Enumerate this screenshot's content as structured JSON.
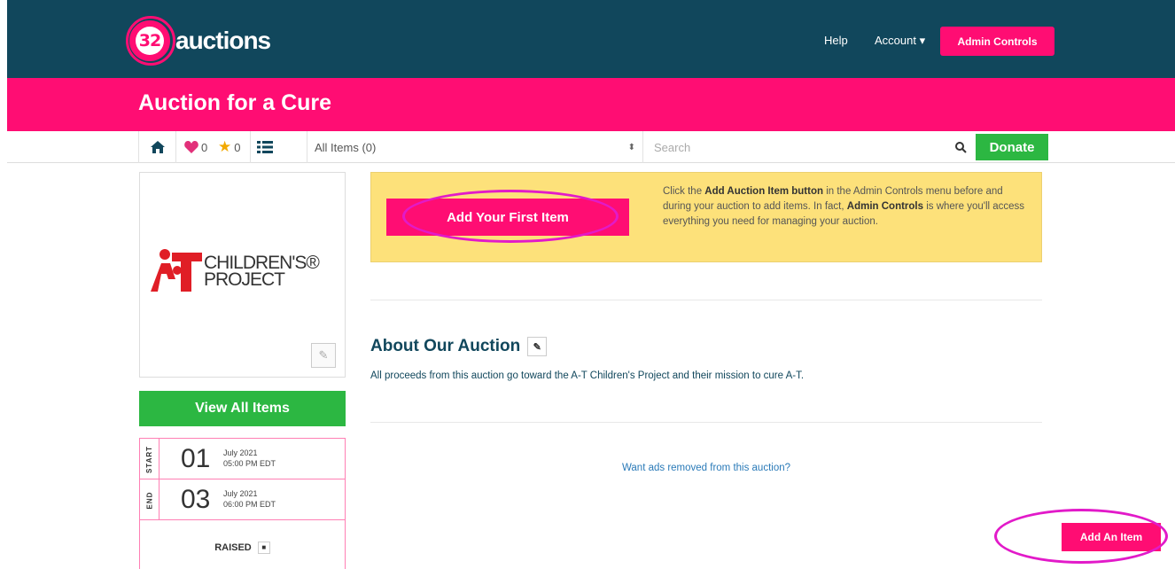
{
  "brand": {
    "logo_number": "32",
    "logo_text": "auctions"
  },
  "nav": {
    "help": "Help",
    "account": "Account ▾",
    "admin_controls": "Admin Controls"
  },
  "auction": {
    "title": "Auction for a Cure"
  },
  "toolbar": {
    "heart_count": "0",
    "star_count": "0",
    "filter_value": "All Items (0)",
    "search_placeholder": "Search",
    "donate": "Donate"
  },
  "org": {
    "name_line1": "CHILDREN'S®",
    "name_line2": "PROJECT"
  },
  "sidebar": {
    "view_all": "View All Items",
    "start_label": "START",
    "start_day": "01",
    "start_month": "July 2021",
    "start_time": "05:00 PM EDT",
    "end_label": "END",
    "end_day": "03",
    "end_month": "July 2021",
    "end_time": "06:00 PM EDT",
    "raised": "RAISED"
  },
  "hint": {
    "button": "Add Your First Item",
    "text_1": "Click the ",
    "bold_1": "Add Auction Item button",
    "text_2": " in the Admin Controls menu before and during your auction to add items. In fact, ",
    "bold_2": "Admin Controls",
    "text_3": " is where you'll access everything you need for managing your auction."
  },
  "about": {
    "title": "About Our Auction",
    "text": "All proceeds from this auction go toward the A-T Children's Project and their mission to cure A-T."
  },
  "ads_link": "Want ads removed from this auction?",
  "add_item": "Add An Item",
  "colors": {
    "navy": "#11475c",
    "pink": "#ff0d73",
    "green": "#2cb742",
    "yellow": "#fde17a",
    "annotation": "#e21ac9"
  }
}
